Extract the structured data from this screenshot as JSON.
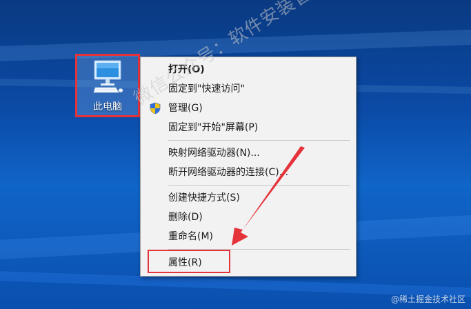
{
  "desktop_icon": {
    "label": "此电脑",
    "icon": "computer-icon"
  },
  "context_menu": {
    "groups": [
      [
        {
          "label": "打开(O)",
          "bold": true
        },
        {
          "label": "固定到\"快速访问\""
        },
        {
          "label": "管理(G)",
          "icon": "shield-icon"
        },
        {
          "label": "固定到\"开始\"屏幕(P)"
        }
      ],
      [
        {
          "label": "映射网络驱动器(N)..."
        },
        {
          "label": "断开网络驱动器的连接(C)..."
        }
      ],
      [
        {
          "label": "创建快捷方式(S)"
        },
        {
          "label": "删除(D)"
        },
        {
          "label": "重命名(M)"
        }
      ],
      [
        {
          "label": "属性(R)"
        }
      ]
    ]
  },
  "annotations": {
    "highlight_color": "#e5333a"
  },
  "watermark": "微信公众号：软件安装管家",
  "credit": "@稀土掘金技术社区"
}
